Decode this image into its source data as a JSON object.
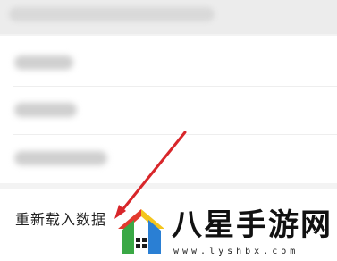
{
  "menu": {
    "reload_label": "重新载入数据"
  },
  "watermark": {
    "name": "八星手游网",
    "url": "www.lyshbx.com"
  },
  "colors": {
    "arrow": "#d8262a",
    "logo_red": "#e33a2e",
    "logo_green": "#3aa845",
    "logo_yellow": "#f4c51c",
    "logo_blue": "#2a7fd4"
  }
}
